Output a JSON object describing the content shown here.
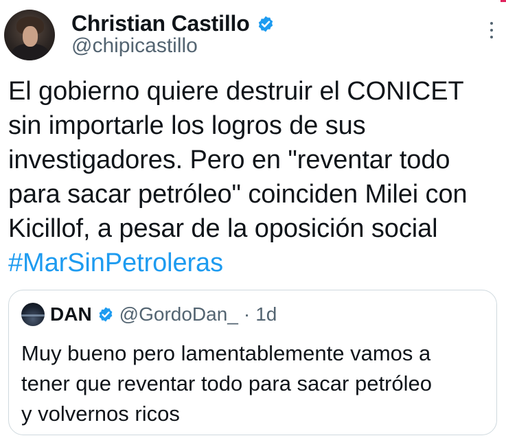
{
  "tweet": {
    "author": {
      "name": "Christian Castillo",
      "handle": "@chipicastillo",
      "verified": true
    },
    "text": "El gobierno quiere destruir el CONICET\nsin importarle los logros de sus\ninvestigadores. Pero en \"reventar todo\npara sacar petróleo\" coinciden Milei con\nKicillof, a pesar de la oposición social\n",
    "hashtag": "#MarSinPetroleras",
    "more_icon": "more-vertical-icon"
  },
  "quote": {
    "author": {
      "name": "DAN",
      "handle": "@GordoDan_",
      "verified": true
    },
    "separator": "·",
    "time": "1d",
    "text": "Muy bueno pero lamentablemente vamos a\ntener que reventar todo para sacar petróleo\ny volvernos ricos"
  },
  "colors": {
    "text": "#0f1419",
    "muted": "#536471",
    "link": "#1d9bf0",
    "border": "#cfd9de",
    "verified": "#1d9bf0"
  }
}
